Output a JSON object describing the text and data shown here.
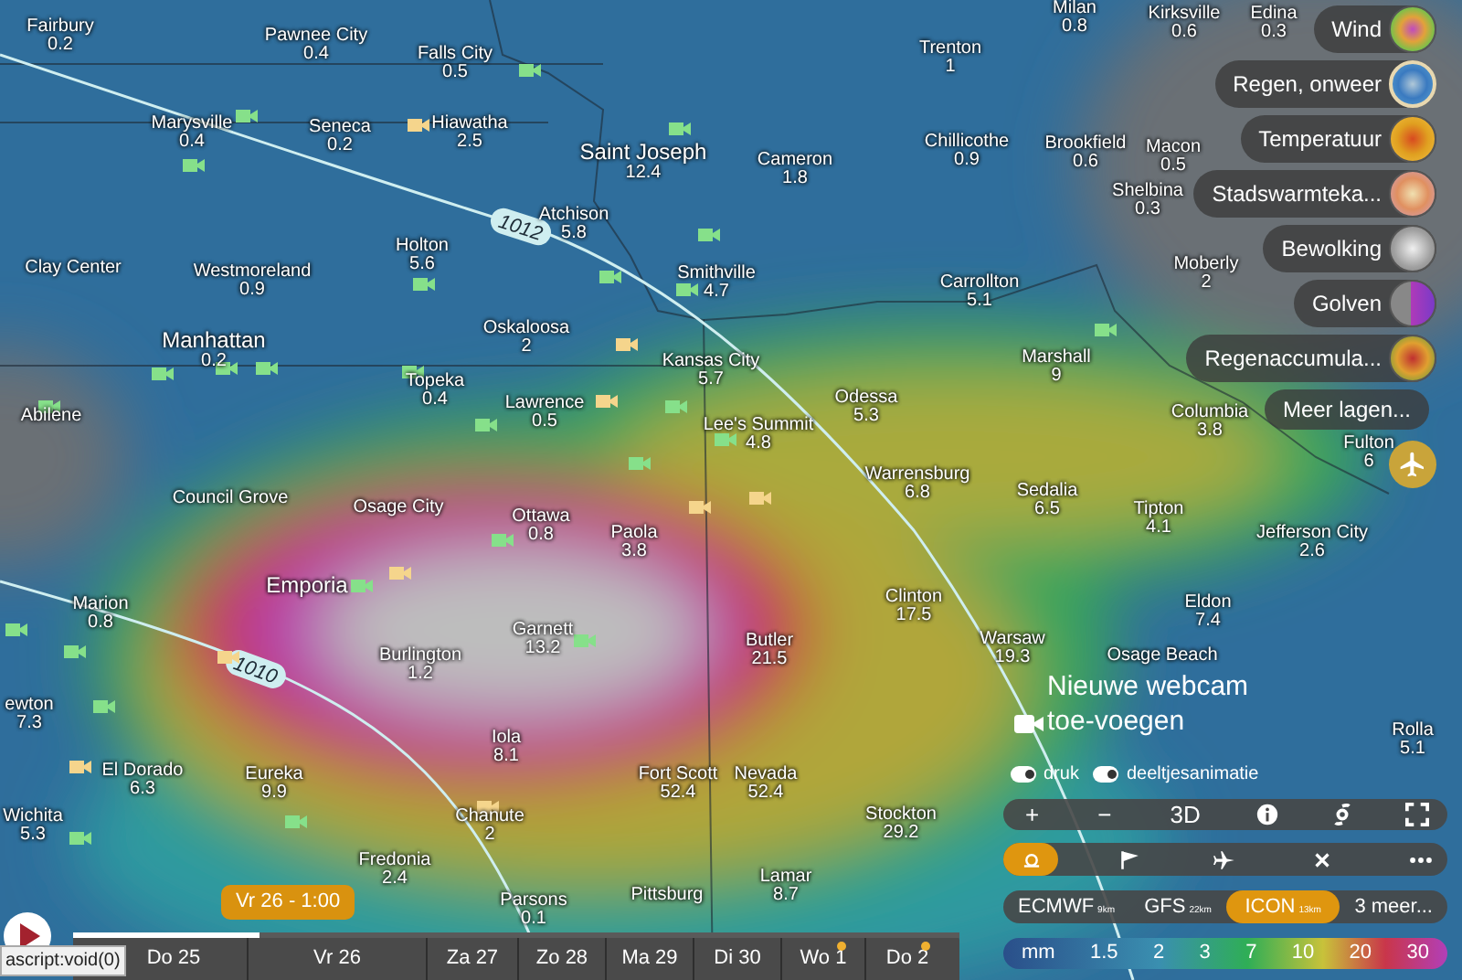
{
  "map": {
    "cities": [
      {
        "name": "Fairbury",
        "value": "0.2"
      },
      {
        "name": "Pawnee City",
        "value": "0.4"
      },
      {
        "name": "Falls City",
        "value": "0.5"
      },
      {
        "name": "Milan",
        "value": "0.8"
      },
      {
        "name": "Kirksville",
        "value": "0.6"
      },
      {
        "name": "Edina",
        "value": "0.3"
      },
      {
        "name": "Trenton",
        "value": "1"
      },
      {
        "name": "Marysville",
        "value": "0.4"
      },
      {
        "name": "Seneca",
        "value": "0.2"
      },
      {
        "name": "Hiawatha",
        "value": "2.5"
      },
      {
        "name": "Saint Joseph",
        "value": "12.4"
      },
      {
        "name": "Cameron",
        "value": "1.8"
      },
      {
        "name": "Chillicothe",
        "value": "0.9"
      },
      {
        "name": "Brookfield",
        "value": "0.6"
      },
      {
        "name": "Macon",
        "value": "0.5"
      },
      {
        "name": "Shelbina",
        "value": "0.3"
      },
      {
        "name": "Atchison",
        "value": "5.8"
      },
      {
        "name": "Holton",
        "value": "5.6"
      },
      {
        "name": "Clay Center"
      },
      {
        "name": "Westmoreland",
        "value": "0.9"
      },
      {
        "name": "Smithville",
        "value": "4.7"
      },
      {
        "name": "Carrollton",
        "value": "5.1"
      },
      {
        "name": "Moberly",
        "value": "2"
      },
      {
        "name": "Manhattan",
        "value": "0.2"
      },
      {
        "name": "Oskaloosa",
        "value": "2"
      },
      {
        "name": "Kansas City",
        "value": "5.7"
      },
      {
        "name": "Marshall",
        "value": "9"
      },
      {
        "name": "Topeka",
        "value": "0.4"
      },
      {
        "name": "Abilene"
      },
      {
        "name": "Lawrence",
        "value": "0.5"
      },
      {
        "name": "Odessa",
        "value": "5.3"
      },
      {
        "name": "Columbia",
        "value": "3.8"
      },
      {
        "name": "Lee's Summit",
        "value": "4.8"
      },
      {
        "name": "Fulton",
        "value": "6"
      },
      {
        "name": "Council Grove"
      },
      {
        "name": "Osage City"
      },
      {
        "name": "Warrensburg",
        "value": "6.8"
      },
      {
        "name": "Sedalia",
        "value": "6.5"
      },
      {
        "name": "Ottawa",
        "value": "0.8"
      },
      {
        "name": "Paola",
        "value": "3.8"
      },
      {
        "name": "Tipton",
        "value": "4.1"
      },
      {
        "name": "Jefferson City",
        "value": "2.6"
      },
      {
        "name": "Emporia"
      },
      {
        "name": "Marion",
        "value": "0.8"
      },
      {
        "name": "Clinton",
        "value": "17.5"
      },
      {
        "name": "Eldon",
        "value": "7.4"
      },
      {
        "name": "Garnett",
        "value": "13.2"
      },
      {
        "name": "Butler",
        "value": "21.5"
      },
      {
        "name": "Warsaw",
        "value": "19.3"
      },
      {
        "name": "Burlington",
        "value": "1.2"
      },
      {
        "name": "ewton",
        "value": "7.3"
      },
      {
        "name": "Osage Beach"
      },
      {
        "name": "Rolla",
        "value": "5.1"
      },
      {
        "name": "Iola",
        "value": "8.1"
      },
      {
        "name": "El Dorado",
        "value": "6.3"
      },
      {
        "name": "Eureka",
        "value": "9.9"
      },
      {
        "name": "Fort Scott",
        "value": "52.4"
      },
      {
        "name": "Nevada",
        "value": "52.4"
      },
      {
        "name": "Wichita",
        "value": "5.3"
      },
      {
        "name": "Chanute",
        "value": "2"
      },
      {
        "name": "Stockton",
        "value": "29.2"
      },
      {
        "name": "Fredonia",
        "value": "2.4"
      },
      {
        "name": "Parsons",
        "value": "0.1"
      },
      {
        "name": "Pittsburg"
      },
      {
        "name": "Lamar",
        "value": "8.7"
      }
    ],
    "webcams": [
      {
        "color": "#86e08a"
      },
      {
        "color": "#86e08a"
      },
      {
        "color": "#86e08a"
      },
      {
        "color": "#f5d58c"
      },
      {
        "color": "#86e08a"
      },
      {
        "color": "#86e08a"
      },
      {
        "color": "#86e08a"
      },
      {
        "color": "#86e08a"
      },
      {
        "color": "#f5d58c"
      },
      {
        "color": "#86e08a"
      },
      {
        "color": "#86e08a"
      },
      {
        "color": "#86e08a"
      },
      {
        "color": "#86e08a"
      },
      {
        "color": "#86e08a"
      },
      {
        "color": "#86e08a"
      },
      {
        "color": "#f5d58c"
      },
      {
        "color": "#86e08a"
      },
      {
        "color": "#86e08a"
      },
      {
        "color": "#86e08a"
      },
      {
        "color": "#86e08a"
      },
      {
        "color": "#86e08a"
      },
      {
        "color": "#f5d58c"
      },
      {
        "color": "#86e08a"
      },
      {
        "color": "#f5d58c"
      },
      {
        "color": "#f5d58c"
      },
      {
        "color": "#86e08a"
      },
      {
        "color": "#86e08a"
      },
      {
        "color": "#86e08a"
      },
      {
        "color": "#86e08a"
      },
      {
        "color": "#f5d58c"
      },
      {
        "color": "#86e08a"
      },
      {
        "color": "#86e08a"
      },
      {
        "color": "#f5d58c"
      },
      {
        "color": "#f5d58c"
      },
      {
        "color": "#86e08a"
      }
    ],
    "isobars": [
      {
        "label": "1012"
      },
      {
        "label": "1010"
      }
    ]
  },
  "layers": [
    {
      "label": "Wind",
      "selected": false
    },
    {
      "label": "Regen, onweer",
      "selected": true
    },
    {
      "label": "Temperatuur",
      "selected": false
    },
    {
      "label": "Stadswarmteka...",
      "selected": false
    },
    {
      "label": "Bewolking",
      "selected": false
    },
    {
      "label": "Golven",
      "selected": false
    },
    {
      "label": "Regenaccumula...",
      "selected": false
    }
  ],
  "more_layers": {
    "label": "Meer lagen..."
  },
  "webcam_prompt": "Nieuwe webcam toe-voegen",
  "toggles": [
    {
      "label": "druk",
      "on": true
    },
    {
      "label": "deeltjesanimatie",
      "on": true
    }
  ],
  "map_tools": [
    {
      "label": "+"
    },
    {
      "label": "−"
    },
    {
      "label": "3D"
    }
  ],
  "mode_buttons": [
    {
      "selected": true
    },
    {
      "selected": false
    },
    {
      "selected": false
    },
    {
      "selected": false
    },
    {
      "selected": false
    }
  ],
  "models": [
    {
      "name": "ECMWF",
      "resolution": "9km",
      "selected": false
    },
    {
      "name": "GFS",
      "resolution": "22km",
      "selected": false
    },
    {
      "name": "ICON",
      "resolution": "13km",
      "selected": true
    },
    {
      "name": "3 meer...",
      "selected": false
    }
  ],
  "legend": {
    "unit": "mm",
    "values": [
      "1.5",
      "2",
      "3",
      "7",
      "10",
      "20",
      "30"
    ]
  },
  "timeline": {
    "tooltip": "Vr 26 - 1:00",
    "level": 0.21,
    "days": [
      {
        "label": "Do 25",
        "marked": false
      },
      {
        "label": "Vr 26",
        "marked": false
      },
      {
        "label": "Za 27",
        "marked": false
      },
      {
        "label": "Zo 28",
        "marked": false
      },
      {
        "label": "Ma 29",
        "marked": false
      },
      {
        "label": "Di 30",
        "marked": false
      },
      {
        "label": "Wo 1",
        "marked": true
      },
      {
        "label": "Do 2",
        "marked": true
      }
    ]
  },
  "status_text": "ascript:void(0)"
}
